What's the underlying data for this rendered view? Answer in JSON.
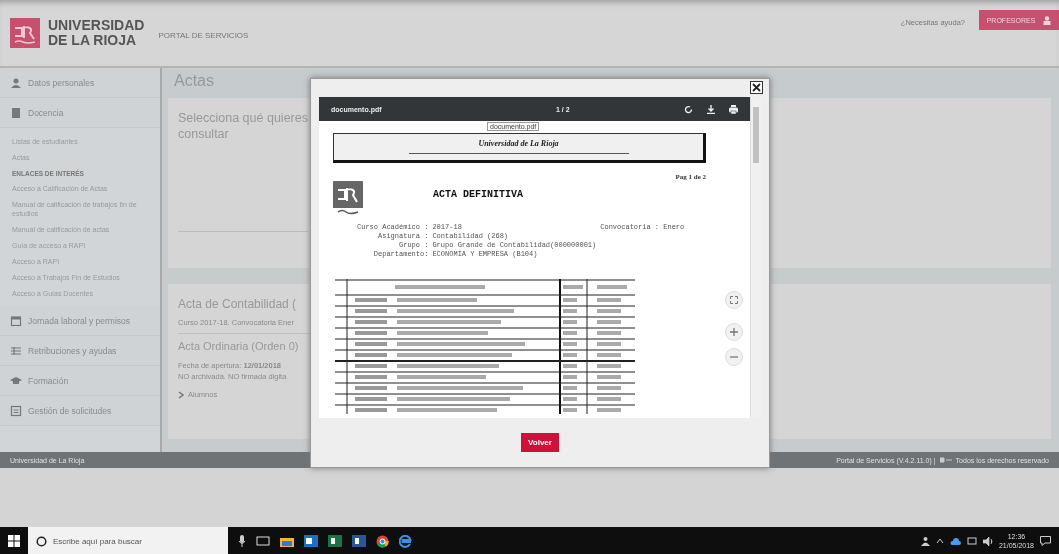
{
  "header": {
    "logo_line1": "UNIVERSIDAD",
    "logo_line2": "DE LA RIOJA",
    "portal": "PORTAL DE SERVICIOS",
    "help_link": "¿Necesitas ayuda?",
    "profile_button": "PROFESORES"
  },
  "sidebar": {
    "items": [
      {
        "kind": "section",
        "label": "Datos personales"
      },
      {
        "kind": "section",
        "label": "Docencia"
      },
      {
        "kind": "link",
        "label": "Listas de estudiantes"
      },
      {
        "kind": "link",
        "label": "Actas"
      },
      {
        "kind": "heading",
        "label": "ENLACES DE INTERÉS"
      },
      {
        "kind": "link",
        "label": "Acceso a Calificación de Actas"
      },
      {
        "kind": "link",
        "label": "Manual de calificación de trabajos fin de estudios"
      },
      {
        "kind": "link",
        "label": "Manual de calificación de actas"
      },
      {
        "kind": "link",
        "label": "Guía de acceso a RAPI"
      },
      {
        "kind": "link",
        "label": "Acceso a RAPI"
      },
      {
        "kind": "link",
        "label": "Acceso a Trabajos Fin de Estudios"
      },
      {
        "kind": "link",
        "label": "Acceso a Guías Docentes"
      },
      {
        "kind": "section",
        "label": "Jornada laboral y permisos"
      },
      {
        "kind": "section",
        "label": "Retribuciones y ayudas"
      },
      {
        "kind": "section",
        "label": "Formación"
      },
      {
        "kind": "section",
        "label": "Gestión de solicitudes"
      }
    ]
  },
  "main": {
    "title": "Actas",
    "select_card": {
      "lines": [
        "Selecciona qué quieres",
        "consultar"
      ]
    },
    "acta_card": {
      "title": "Acta de Contabilidad (",
      "subtitle": "Curso 2017-18. Convocatoria Ener",
      "order_title": "Acta Ordinaria (Orden 0)",
      "opening": "Fecha de apertura: **12/01/2018**",
      "status": "NO archivada. NO firmada digita",
      "toggle": "Alumnos"
    }
  },
  "modal": {
    "file_name": "documento.pdf",
    "page_indicator": "1 / 2",
    "tooltip": "documento.pdf",
    "document": {
      "header": "Universidad de La Rioja",
      "page_number": "Pag 1 de 2",
      "title": "ACTA DEFINITIVA",
      "fields": [
        {
          "label": "Curso Académico :",
          "value": "2017-18",
          "extra": "Convocatoria : Enero"
        },
        {
          "label": "Asignatura :",
          "value": "Contabilidad (268)"
        },
        {
          "label": "Grupo :",
          "value": "Grupo Grande de Contabilidad(000000001)"
        },
        {
          "label": "Departamento:",
          "value": "ECONOMÍA Y EMPRESA (B104)"
        }
      ]
    },
    "button": "Volver"
  },
  "footer": {
    "left": "Universidad de La Rioja",
    "version": "Portal de Servicios (V.4.2.11.0) |",
    "rights": "Todos los derechos reservado"
  },
  "taskbar": {
    "search_placeholder": "Escribe aquí para buscar",
    "time": "12:36",
    "date": "21/05/2018"
  }
}
